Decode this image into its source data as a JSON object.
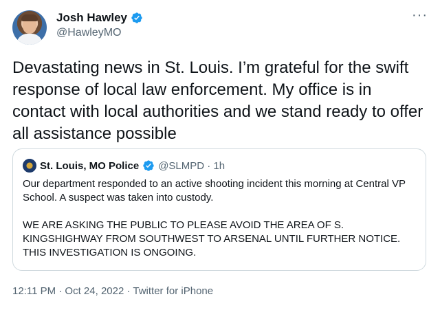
{
  "author": {
    "name": "Josh Hawley",
    "handle": "@HawleyMO"
  },
  "more_label": "···",
  "tweet_text": "Devastating news in St. Louis. I’m grateful for the swift response of local law enforcement. My office is in contact with local authorities and we stand ready to offer all assistance possible",
  "quoted": {
    "name": "St. Louis, MO Police",
    "meta": "@SLMPD · 1h",
    "paragraph1": "Our department responded to an active shooting incident this morning at Central VP School. A suspect was taken into custody.",
    "paragraph2": "WE ARE ASKING THE PUBLIC TO PLEASE AVOID THE AREA OF S. KINGSHIGHWAY FROM SOUTHWEST TO ARSENAL UNTIL FURTHER NOTICE. THIS INVESTIGATION IS ONGOING."
  },
  "footer": "12:11 PM · Oct 24, 2022 · Twitter for iPhone",
  "colors": {
    "verified": "#1d9bf0",
    "secondary_text": "#536471",
    "border": "#cfd9de"
  },
  "icons": [
    "verified-badge-icon",
    "more-options-icon"
  ]
}
